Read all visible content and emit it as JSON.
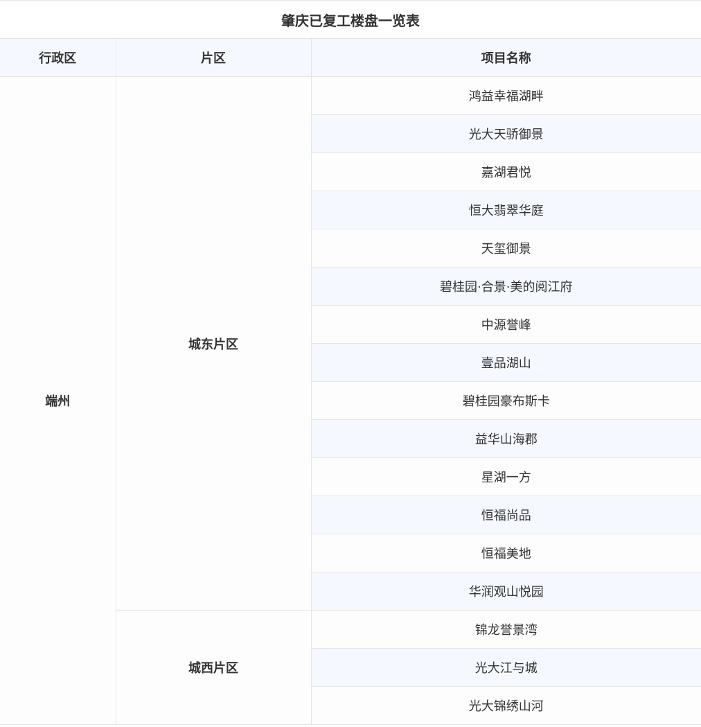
{
  "table": {
    "title": "肇庆已复工楼盘一览表",
    "headers": {
      "district": "行政区",
      "area": "片区",
      "project": "项目名称"
    },
    "district": "端州",
    "groups": [
      {
        "area": "城东片区",
        "projects": [
          "鸿益幸福湖畔",
          "光大天骄御景",
          "嘉湖君悦",
          "恒大翡翠华庭",
          "天玺御景",
          "碧桂园·合景·美的阅江府",
          "中源誉峰",
          "壹品湖山",
          "碧桂园豪布斯卡",
          "益华山海郡",
          "星湖一方",
          "恒福尚品",
          "恒福美地",
          "华润观山悦园"
        ]
      },
      {
        "area": "城西片区",
        "projects": [
          "锦龙誉景湾",
          "光大江与城",
          "光大锦绣山河"
        ]
      }
    ]
  }
}
